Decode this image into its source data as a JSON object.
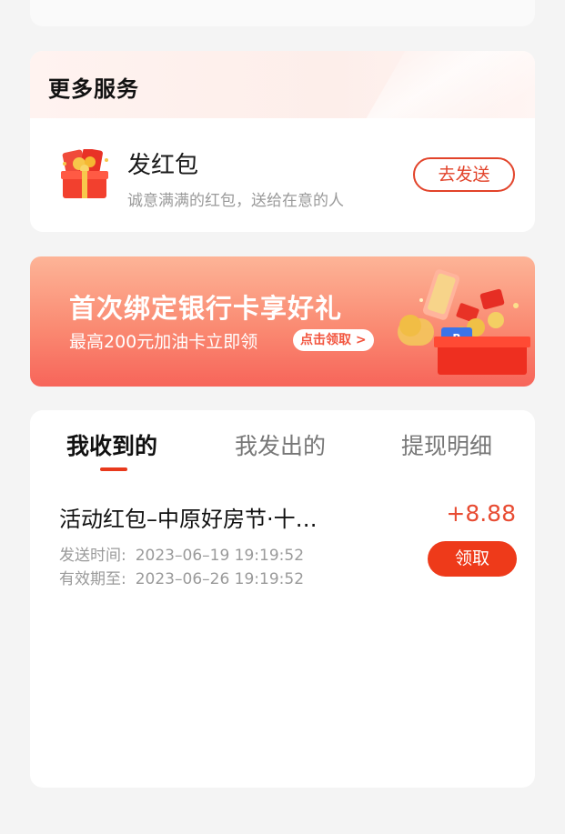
{
  "services": {
    "title": "更多服务",
    "item": {
      "name": "发红包",
      "desc": "诚意满满的红包，送给在意的人",
      "button": "去发送",
      "icon": "red-envelope-gift-icon"
    }
  },
  "banner": {
    "title": "首次绑定银行卡享好礼",
    "subtitle": "最高200元加油卡立即领",
    "button": "点击领取 >"
  },
  "tabs": [
    {
      "label": "我收到的",
      "active": true
    },
    {
      "label": "我发出的",
      "active": false
    },
    {
      "label": "提现明细",
      "active": false
    }
  ],
  "records": [
    {
      "title": "活动红包–中原好房节·十…",
      "amount": "+8.88",
      "sent_label": "发送时间:",
      "sent_value": "2023–06–19  19:19:52",
      "expire_label": "有效期至:",
      "expire_value": "2023–06–26  19:19:52",
      "button": "领取"
    }
  ],
  "colors": {
    "accent": "#e8391c",
    "banner_top": "#fdb497",
    "banner_bottom": "#f7655a",
    "page_bg": "#f4f4f4"
  }
}
